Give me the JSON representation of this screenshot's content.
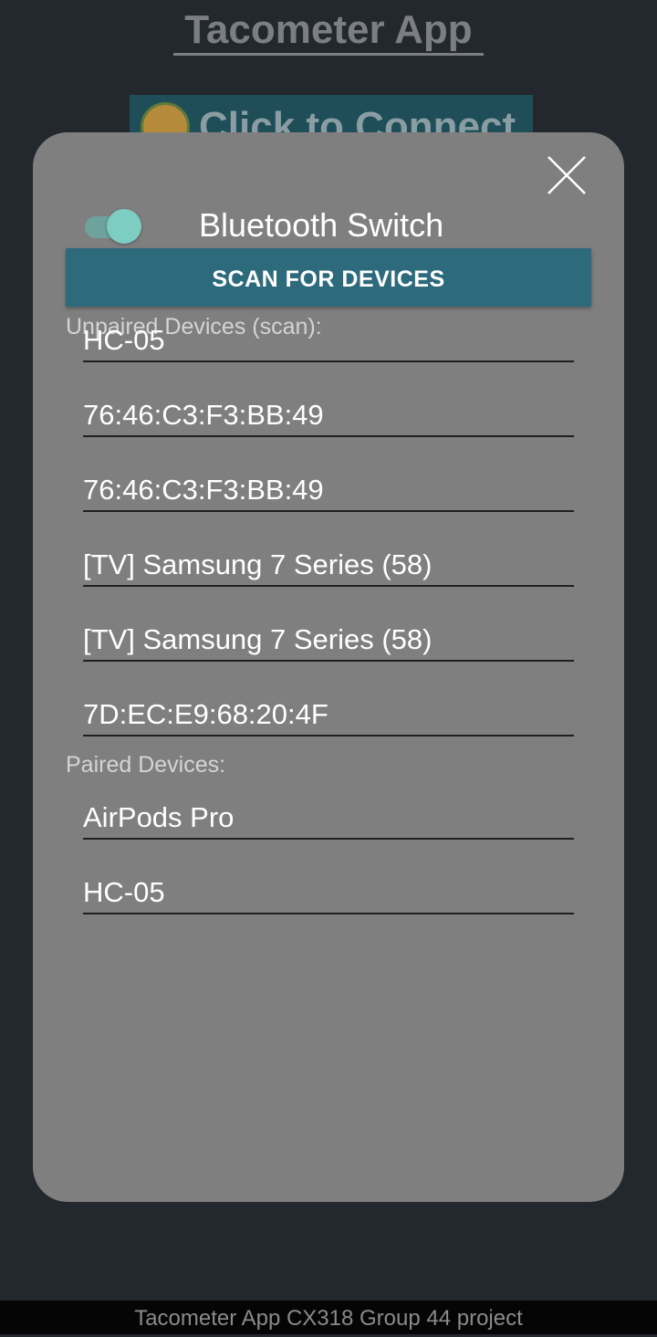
{
  "app": {
    "title": "Tacometer App",
    "connect_label": "Click to Connect",
    "footer": "Tacometer App CX318 Group 44 project"
  },
  "dialog": {
    "switch_label": "Bluetooth Switch",
    "switch_on": true,
    "scan_label": "SCAN FOR DEVICES",
    "unpaired_label": "Unpaired Devices (scan):",
    "paired_label": "Paired Devices:",
    "unpaired": [
      "HC-05",
      "76:46:C3:F3:BB:49",
      "76:46:C3:F3:BB:49",
      "[TV] Samsung 7 Series (58)",
      "[TV] Samsung 7 Series (58)",
      "7D:EC:E9:68:20:4F"
    ],
    "paired": [
      "AirPods Pro",
      "HC-05"
    ]
  },
  "colors": {
    "background": "#23272e",
    "dialog": "#7f7f7f",
    "scan_button": "#2d6a7c",
    "toggle_thumb": "#7ecdc3"
  },
  "icons": {
    "close": "close-icon",
    "logo": "app-logo-icon"
  }
}
